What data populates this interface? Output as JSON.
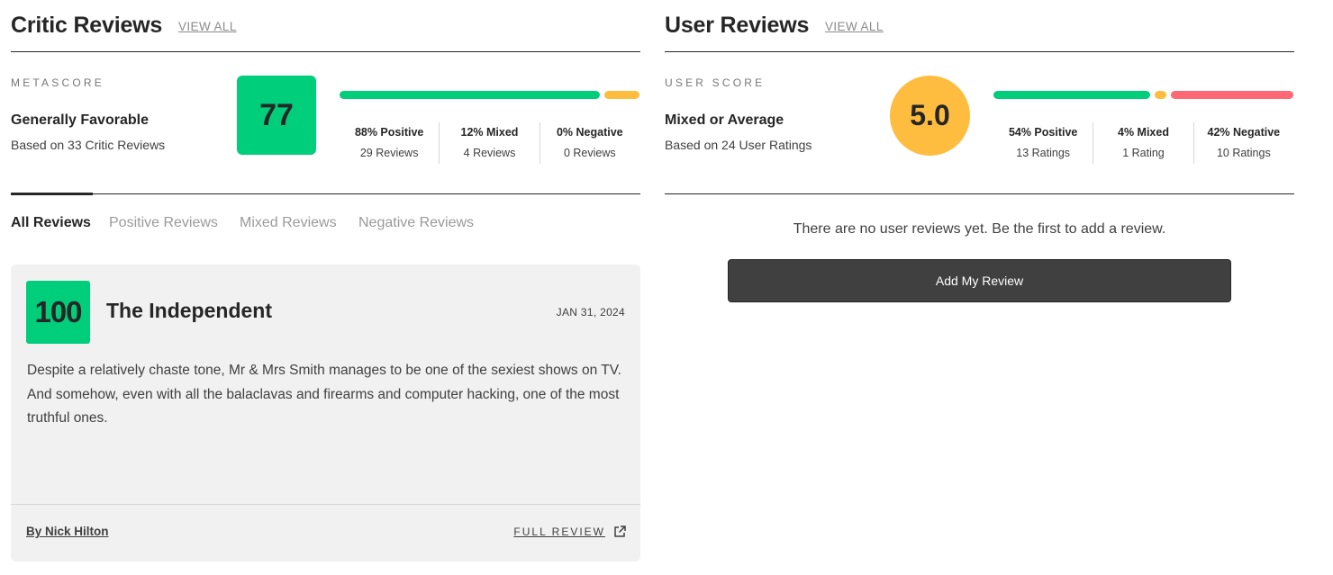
{
  "critic": {
    "title": "Critic Reviews",
    "view_all": "VIEW ALL",
    "score_label": "METASCORE",
    "verdict": "Generally Favorable",
    "based_on": "Based on 33 Critic Reviews",
    "score": "77",
    "score_color": "#00ce7a",
    "distribution": {
      "positive_pct": 88,
      "mixed_pct": 12,
      "negative_pct": 0,
      "positive": "88% Positive",
      "positive_count": "29 Reviews",
      "mixed": "12% Mixed",
      "mixed_count": "4 Reviews",
      "negative": "0% Negative",
      "negative_count": "0 Reviews"
    },
    "filters": [
      "All Reviews",
      "Positive Reviews",
      "Mixed Reviews",
      "Negative Reviews"
    ],
    "active_filter": "All Reviews",
    "review": {
      "score": "100",
      "publication": "The Independent",
      "date": "JAN 31, 2024",
      "quote": "Despite a relatively chaste tone, Mr & Mrs Smith manages to be one of the sexiest shows on TV. And somehow, even with all the balaclavas and firearms and computer hacking, one of the most truthful ones.",
      "author": "By Nick Hilton",
      "full_review": "FULL REVIEW",
      "link_icon": "external-link-icon"
    }
  },
  "user": {
    "title": "User Reviews",
    "view_all": "VIEW ALL",
    "score_label": "USER SCORE",
    "verdict": "Mixed or Average",
    "based_on": "Based on 24 User Ratings",
    "score": "5.0",
    "score_color": "#ffbd3f",
    "distribution": {
      "positive_pct": 54,
      "mixed_pct": 4,
      "negative_pct": 42,
      "positive": "54% Positive",
      "positive_count": "13 Ratings",
      "mixed": "4% Mixed",
      "mixed_count": "1 Rating",
      "negative": "42% Negative",
      "negative_count": "10 Ratings"
    },
    "empty_message": "There are no user reviews yet. Be the first to add a review.",
    "add_review": "Add My Review"
  },
  "colors": {
    "positive": "#00ce7a",
    "mixed": "#ffbd3f",
    "negative": "#ff6874"
  }
}
